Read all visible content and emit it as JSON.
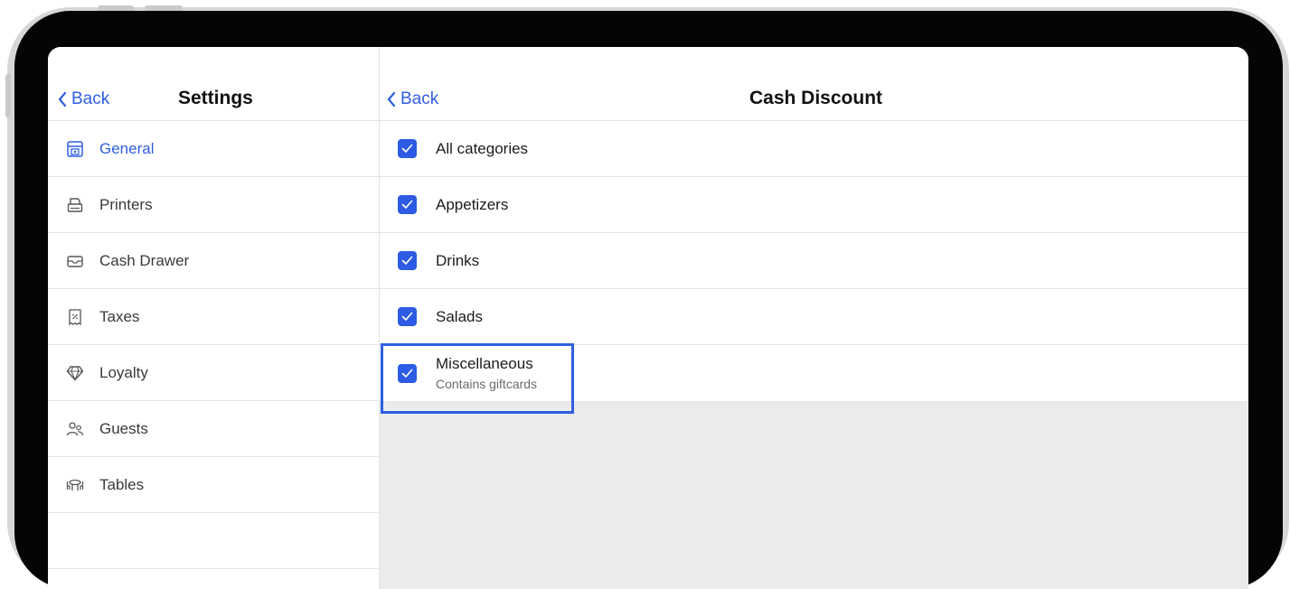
{
  "left_panel": {
    "back_label": "Back",
    "title": "Settings",
    "items": [
      {
        "label": "General",
        "icon": "storefront-icon",
        "active": true
      },
      {
        "label": "Printers",
        "icon": "printer-icon",
        "active": false
      },
      {
        "label": "Cash Drawer",
        "icon": "cash-drawer-icon",
        "active": false
      },
      {
        "label": "Taxes",
        "icon": "tax-receipt-icon",
        "active": false
      },
      {
        "label": "Loyalty",
        "icon": "diamond-icon",
        "active": false
      },
      {
        "label": "Guests",
        "icon": "guests-icon",
        "active": false
      },
      {
        "label": "Tables",
        "icon": "table-icon",
        "active": false
      }
    ]
  },
  "right_panel": {
    "back_label": "Back",
    "title": "Cash Discount",
    "categories": [
      {
        "label": "All categories",
        "checked": true
      },
      {
        "label": "Appetizers",
        "checked": true
      },
      {
        "label": "Drinks",
        "checked": true
      },
      {
        "label": "Salads",
        "checked": true
      },
      {
        "label": "Miscellaneous",
        "subtitle": "Contains giftcards",
        "checked": true
      }
    ]
  },
  "colors": {
    "accent": "#2f5fe0",
    "checkbox": "#2d5be3",
    "highlight_border": "#2f5fe0",
    "empty_area": "#ebebee"
  }
}
